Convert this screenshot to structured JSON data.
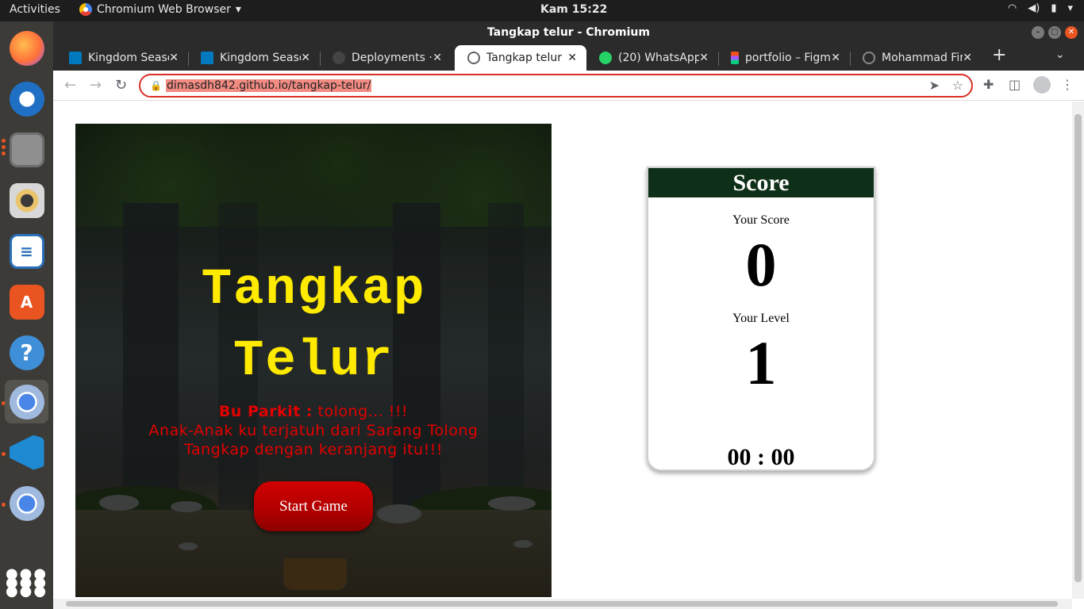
{
  "topbar": {
    "activities": "Activities",
    "app_name": "Chromium Web Browser",
    "clock": "Kam 15:22"
  },
  "dock": {
    "items": [
      {
        "name": "firefox-icon",
        "color": "#ff7139"
      },
      {
        "name": "thunderbird-icon",
        "color": "#1f6fc5"
      },
      {
        "name": "files-icon",
        "color": "#8f8f8f"
      },
      {
        "name": "rhythmbox-icon",
        "color": "#e9c46a"
      },
      {
        "name": "libreoffice-writer-icon",
        "color": "#2a6fb8"
      },
      {
        "name": "software-center-icon",
        "color": "#e95420"
      },
      {
        "name": "help-icon",
        "color": "#3f8ed8"
      },
      {
        "name": "chromium-icon",
        "color": "#4a86e8"
      },
      {
        "name": "vscode-icon",
        "color": "#1f8ad2"
      },
      {
        "name": "chromium-icon",
        "color": "#4a86e8"
      },
      {
        "name": "show-apps-icon",
        "color": "#ffffff"
      }
    ]
  },
  "window": {
    "title": "Tangkap telur - Chromium"
  },
  "tabs": [
    {
      "title": "Kingdom Seaso",
      "icon": "trello-icon",
      "icon_color": "#0079bf",
      "active": false
    },
    {
      "title": "Kingdom Seaso",
      "icon": "trello-icon",
      "icon_color": "#0079bf",
      "active": false
    },
    {
      "title": "Deployments · ",
      "icon": "github-icon",
      "icon_color": "#444444",
      "active": false
    },
    {
      "title": "Tangkap telur",
      "icon": "globe-icon",
      "icon_color": "#5f6368",
      "active": true
    },
    {
      "title": "(20) WhatsApp",
      "icon": "whatsapp-icon",
      "icon_color": "#25d366",
      "active": false
    },
    {
      "title": "portfolio – Figm",
      "icon": "figma-icon",
      "icon_color": "#f24e1e",
      "active": false
    },
    {
      "title": "Mohammad Fir",
      "icon": "globe-icon",
      "icon_color": "#888888",
      "active": false
    }
  ],
  "toolbar": {
    "url": "dimasdh842.github.io/tangkap-telur/"
  },
  "game": {
    "title_line1": "Tangkap",
    "title_line2": "Telur",
    "speaker": "Bu Parkit :",
    "line1": " tolong... !!!",
    "line2": "Anak-Anak ku terjatuh dari Sarang Tolong",
    "line3": "Tangkap dengan keranjang itu!!!",
    "start_label": "Start Game",
    "title_color": "#ffea00",
    "story_color": "#e30000"
  },
  "score": {
    "header": "Score",
    "score_label": "Your Score",
    "score_value": "0",
    "level_label": "Your Level",
    "level_value": "1",
    "timer": "00 : 00",
    "header_color": "#0f3018"
  }
}
